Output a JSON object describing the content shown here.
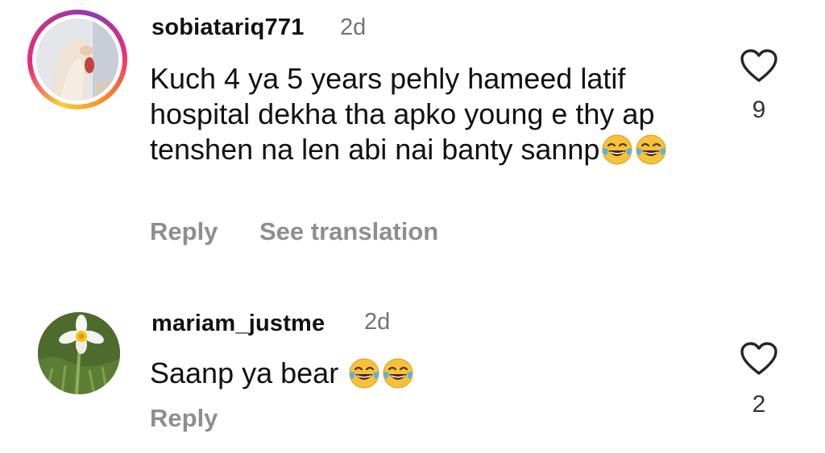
{
  "comments": [
    {
      "username": "sobiatariq771",
      "time": "2d",
      "text": "Kuch 4 ya 5 years pehly hameed latif hospital dekha tha apko young e thy ap tenshen na len abi nai banty sannp",
      "emoji": [
        "face-with-tears-of-joy",
        "face-with-tears-of-joy"
      ],
      "likes": "9",
      "actions": {
        "reply": "Reply",
        "translate": "See translation"
      },
      "avatar_ring": true
    },
    {
      "username": "mariam_justme",
      "time": "2d",
      "text": "Saanp ya bear",
      "emoji": [
        "face-with-tears-of-joy",
        "face-with-tears-of-joy"
      ],
      "likes": "2",
      "actions": {
        "reply": "Reply"
      },
      "avatar_ring": false
    }
  ],
  "icons": {
    "like": "heart-outline-icon",
    "emoji": "face-with-tears-of-joy"
  },
  "colors": {
    "text": "#111111",
    "muted": "#8e8e8e",
    "timestamp": "#737373"
  }
}
